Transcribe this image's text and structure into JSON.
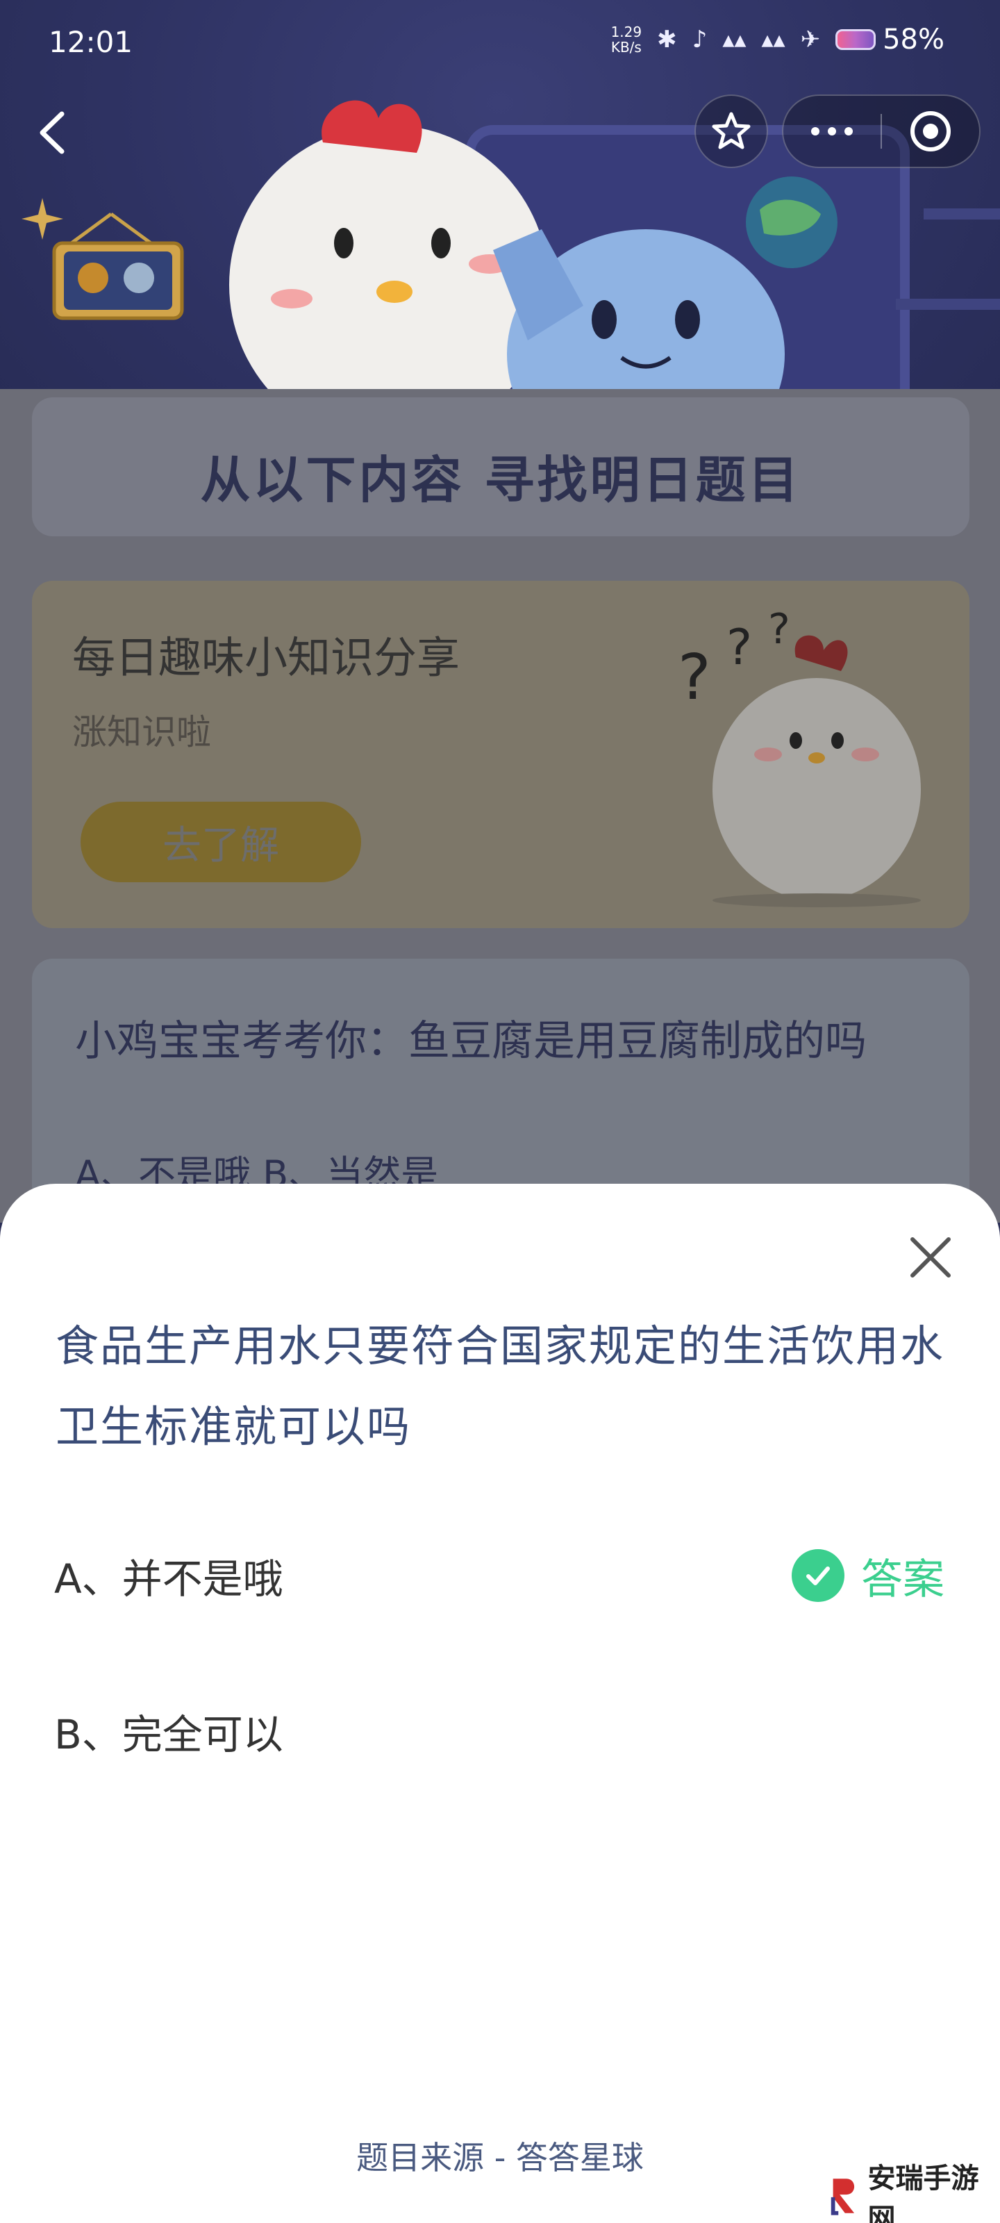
{
  "status_bar": {
    "time": "12:01",
    "net_speed_value": "1.29",
    "net_speed_unit": "KB/s",
    "battery": "58%"
  },
  "nav": {
    "back_icon": "chevron-left-icon",
    "favorite_icon": "star-outline-icon",
    "more_icon": "more-dots-icon",
    "close_miniapp_icon": "target-circle-icon"
  },
  "banner": {
    "heading": "从以下内容 寻找明日题目"
  },
  "fun_card": {
    "title": "每日趣味小知识分享",
    "subtitle": "涨知识啦",
    "button": "去了解"
  },
  "quiz_card": {
    "question": "小鸡宝宝考考你：鱼豆腐是用豆腐制成的吗",
    "options": "A、不是哦 B、当然是"
  },
  "sheet": {
    "question": "食品生产用水只要符合国家规定的生活饮用水卫生标准就可以吗",
    "option_a": "A、并不是哦",
    "option_b": "B、完全可以",
    "answer_label": "答案",
    "source": "题目来源 - 答答星球"
  },
  "watermark": {
    "text": "安瑞手游网"
  },
  "colors": {
    "accent_green": "#3bcf8e",
    "question_blue": "#3a4c77",
    "banner_navy": "#2e3262"
  }
}
